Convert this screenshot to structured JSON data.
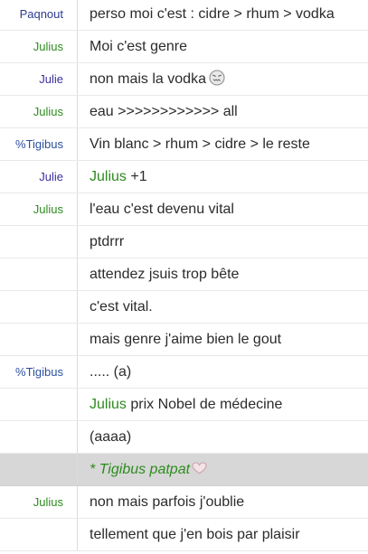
{
  "colors": {
    "Paqnout": "#2d3b8f",
    "Julius": "#2e8b1f",
    "Julie": "#3a2f9c",
    "%Tigibus": "#2a4fa0",
    "mention": "#2e8b1f",
    "action_bg": "#d7d7d7"
  },
  "messages": [
    {
      "nick": "Paqnout",
      "text": "perso moi c'est : cidre > rhum > vodka"
    },
    {
      "nick": "Julius",
      "text": "Moi c'est genre"
    },
    {
      "nick": "Julie",
      "text": "non mais la vodka",
      "icon": "disgusted-face-icon"
    },
    {
      "nick": "Julius",
      "text": "eau >>>>>>>>>>>> all"
    },
    {
      "nick": "%Tigibus",
      "text": "Vin blanc > rhum > cidre > le reste"
    },
    {
      "nick": "Julie",
      "mention": "Julius",
      "text": " +1"
    },
    {
      "nick": "Julius",
      "text": "l'eau c'est devenu vital"
    },
    {
      "nick": "",
      "text": "ptdrrr"
    },
    {
      "nick": "",
      "text": "attendez jsuis trop bête"
    },
    {
      "nick": "",
      "text": "c'est vital."
    },
    {
      "nick": "",
      "text": "mais genre j'aime bien le gout"
    },
    {
      "nick": "%Tigibus",
      "text": "..... (a)"
    },
    {
      "nick": "",
      "mention": "Julius",
      "text": " prix Nobel de médecine"
    },
    {
      "nick": "",
      "text": "(aaaa)"
    },
    {
      "nick": "",
      "action": "* Tigibus patpat",
      "icon": "heart-icon"
    },
    {
      "nick": "Julius",
      "text": "non mais parfois j'oublie"
    },
    {
      "nick": "",
      "text": "tellement que j'en bois par plaisir"
    }
  ]
}
